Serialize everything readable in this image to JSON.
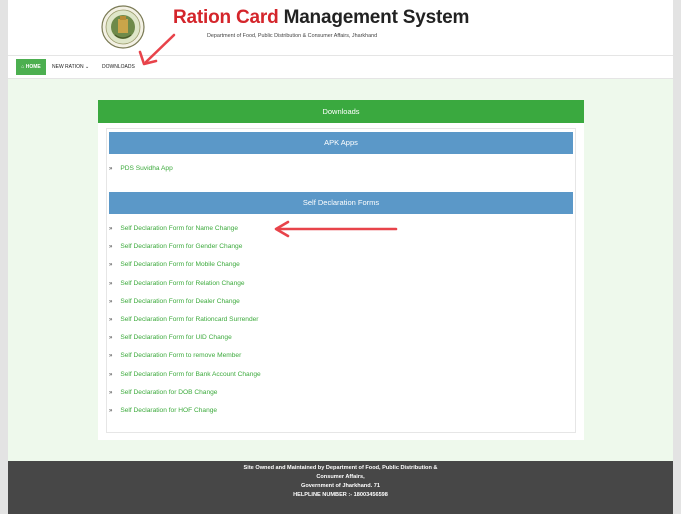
{
  "header": {
    "title_accent": "Ration Card",
    "title_rest": " Management System",
    "subtitle": "Department of Food, Public Distribution & Consumer Affairs, Jharkhand"
  },
  "nav": {
    "home_icon": "home-icon",
    "home": "HOME",
    "new_ration": "NEW RATION",
    "new_ration_caret": "⌄",
    "downloads": "DOWNLOADS"
  },
  "panel": {
    "title": "Downloads",
    "apk": {
      "heading": "APK Apps",
      "items": [
        "PDS Suvidha App"
      ]
    },
    "forms": {
      "heading": "Self Declaration Forms",
      "items": [
        "Self Declaration Form for Name Change",
        "Self Declaration Form for Gender Change",
        "Self Declaration Form for Mobile Change",
        "Self Declaration Form for Relation Change",
        "Self Declaration Form for Dealer Change",
        "Self Declaration Form for Rationcard Surrender",
        "Self Declaration Form for UID Change",
        "Self Declaration Form to remove Member",
        "Self Declaration Form for Bank Account Change",
        "Self Declaration for DOB Change",
        "Self Declaration for HOF Change"
      ]
    },
    "bullet": "»"
  },
  "footer": {
    "line1": "Site Owned and Maintained by Department of Food, Public Distribution &",
    "line2": "Consumer Affairs,",
    "line3": "Government of Jharkhand. 71",
    "line4": "HELPLINE NUMBER :- 18003456598"
  },
  "colors": {
    "accent_red": "#d4252b",
    "green": "#3aa93f",
    "blue": "#5b98c8",
    "annotation_arrow": "#e8434a"
  }
}
